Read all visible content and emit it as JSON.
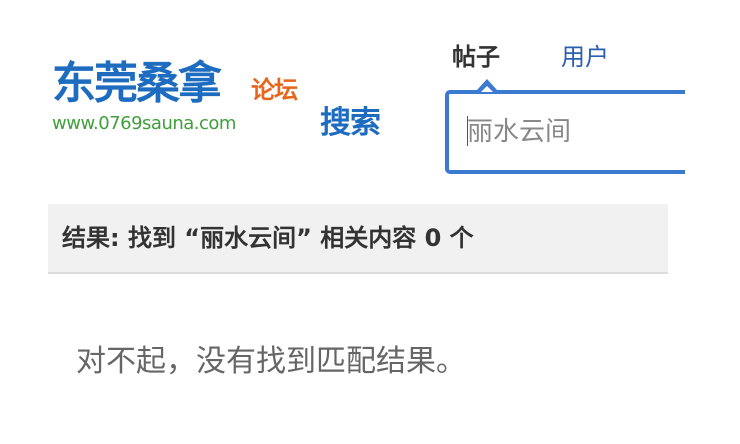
{
  "logo": {
    "name": "东莞桑拿",
    "tag": "论坛",
    "url": "www.0769sauna.com",
    "search": "搜索"
  },
  "tabs": [
    {
      "label": "帖子",
      "active": true
    },
    {
      "label": "用户",
      "active": false
    }
  ],
  "search": {
    "value": "丽水云间",
    "placeholder": ""
  },
  "results": {
    "prefix": "结果: 找到 “",
    "keyword": "丽水云间",
    "middle": "” 相关内容 ",
    "count": "0",
    "suffix": " 个"
  },
  "empty_message": "对不起，没有找到匹配结果。",
  "colors": {
    "brand_blue": "#1d6cc0",
    "accent_orange": "#e8661c",
    "url_green": "#3fa03b",
    "search_border": "#3b7ad1"
  }
}
